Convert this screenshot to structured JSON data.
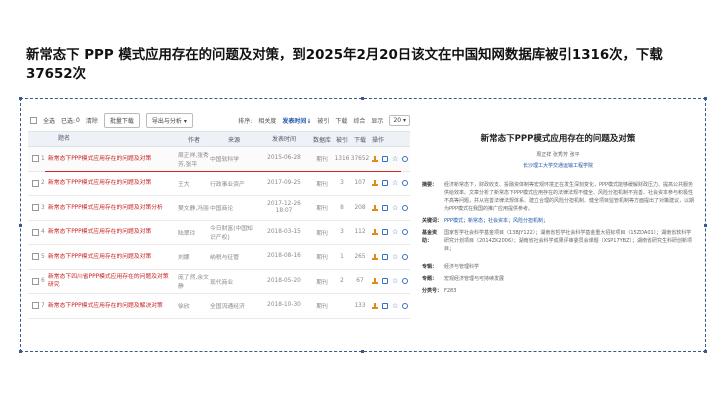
{
  "slide": {
    "title": "新常态下 PPP 模式应用存在的问题及对策，到2025年2月20日该文在中国知网数据库被引1316次，下载 37652次"
  },
  "toolbar": {
    "select_all": "全选",
    "selected": "已选:",
    "selected_count": "0",
    "clear": "清除",
    "batch_download": "批量下载",
    "export_analysis": "导出与分析 ▾",
    "sort_label": "排序:",
    "sort_relevance": "相关度",
    "sort_date": "发表时间↓",
    "sort_cited": "被引",
    "sort_download": "下载",
    "sort_comprehensive": "综合",
    "display_label": "显示",
    "display_count": "20 ▾"
  },
  "table": {
    "headers": {
      "title": "题名",
      "author": "作者",
      "source": "来源",
      "date": "发表时间",
      "database": "数据库",
      "cited": "被引",
      "downloads": "下载",
      "ops": "操作"
    },
    "rows": [
      {
        "no": "1",
        "title": "新常态下PPP模式应用存在的问题及对策",
        "author": "周正祥,张秀芳,张平",
        "source": "中国软科学",
        "date": "2015-06-28",
        "db": "期刊",
        "cited": "1316",
        "downloads": "37652"
      },
      {
        "no": "2",
        "title": "新常态下PPP模式应用存在的问题及对策",
        "author": "王大",
        "source": "行政事业资产",
        "date": "2017-09-25",
        "db": "期刊",
        "cited": "3",
        "downloads": "107"
      },
      {
        "no": "3",
        "title": "新常态下PPP模式应用存在的问题及对策分析",
        "author": "樊文静,冯丽",
        "source": "中国商论",
        "date": "2017-12-26 18:07",
        "db": "期刊",
        "cited": "8",
        "downloads": "208"
      },
      {
        "no": "4",
        "title": "新常态下PPP模式应用存在的问题及对策",
        "author": "陆翠玲",
        "source": "今日财富(中国知识产权)",
        "date": "2018-03-15",
        "db": "期刊",
        "cited": "3",
        "downloads": "112"
      },
      {
        "no": "5",
        "title": "新常态下PPP模式应用存在的问题及对策",
        "author": "刘娜",
        "source": "纳税与征管",
        "date": "2018-08-16",
        "db": "期刊",
        "cited": "1",
        "downloads": "265"
      },
      {
        "no": "6",
        "title": "新常态下四川省PPP模式应用存在的问题及对策研究",
        "author": "庞了然,余文静",
        "source": "现代商业",
        "date": "2018-05-20",
        "db": "期刊",
        "cited": "2",
        "downloads": "67"
      },
      {
        "no": "7",
        "title": "新常态下PPP模式应用存在的问题及解决对策",
        "author": "徐欣",
        "source": "全国流通经济",
        "date": "2018-10-30",
        "db": "期刊",
        "cited": "",
        "downloads": "133"
      }
    ]
  },
  "abstract": {
    "title": "新常态下PPP模式应用存在的问题及对策",
    "authors": "周正祥  张秀芳  张平",
    "institution": "长沙理工大学交通运输工程学院",
    "abstract_label": "摘要：",
    "abstract_text": "经济新常态下，财政收支、投融资体制等宏观环境正在发生深刻变化，PPP模式能够缓解财政压力、提高公共服务供给效率。文章分析了新常态下PPP模式应用存在的法律法规不健全、风险分担机制不完善、社会资本参与积极性不高等问题，并从完善法律法规体系、建立合理的风险分担机制、健全项目监管机制等方面提出了对策建议，以期为PPP模式在我国的推广应用提供参考。",
    "keywords_label": "关键词：",
    "keywords": "PPP模式；新常态；社会资本；风险分担机制；",
    "fund_label": "基金资助：",
    "fund": "国家哲学社会科学基金项目（13BJY122）；湖南省哲学社会科学基金重大招标项目（15ZDA01）；湖南省软科学研究计划项目（2014ZK2006）；湖南省社会科学成果评审委员会课题（XSP17YBZ）；湖南省研究生科研创新项目；",
    "column_label": "专辑：",
    "column": "经济与管理科学",
    "subject_label": "专题：",
    "subject": "宏观经济管理与可持续发展",
    "class_label": "分类号：",
    "class_no": "F283"
  }
}
